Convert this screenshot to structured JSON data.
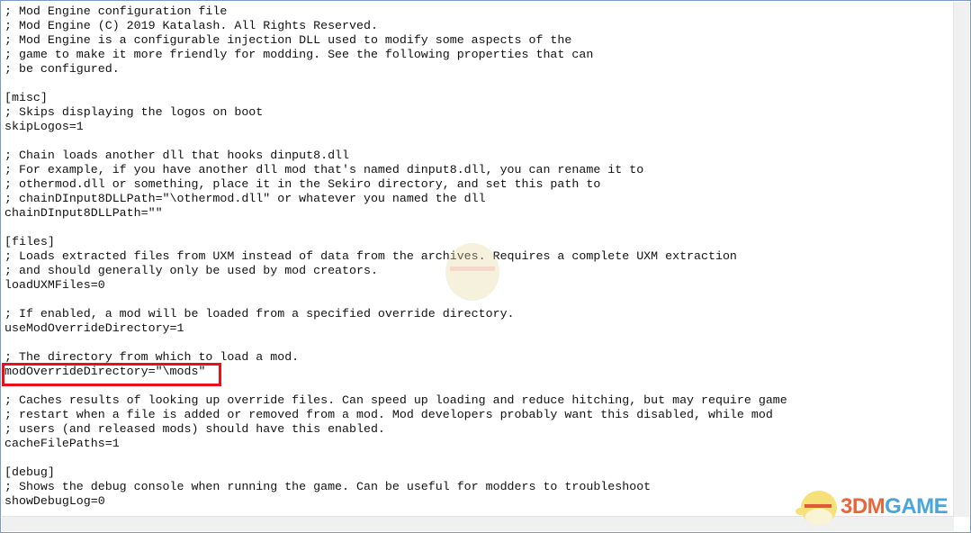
{
  "editor": {
    "lines": [
      "; Mod Engine configuration file",
      "; Mod Engine (C) 2019 Katalash. All Rights Reserved.",
      "; Mod Engine is a configurable injection DLL used to modify some aspects of the",
      "; game to make it more friendly for modding. See the following properties that can",
      "; be configured.",
      "",
      "[misc]",
      "; Skips displaying the logos on boot",
      "skipLogos=1",
      "",
      "; Chain loads another dll that hooks dinput8.dll",
      "; For example, if you have another dll mod that's named dinput8.dll, you can rename it to",
      "; othermod.dll or something, place it in the Sekiro directory, and set this path to",
      "; chainDInput8DLLPath=\"\\othermod.dll\" or whatever you named the dll",
      "chainDInput8DLLPath=\"\"",
      "",
      "[files]",
      "; Loads extracted files from UXM instead of data from the archives. Requires a complete UXM extraction",
      "; and should generally only be used by mod creators.",
      "loadUXMFiles=0",
      "",
      "; If enabled, a mod will be loaded from a specified override directory.",
      "useModOverrideDirectory=1",
      "",
      "; The directory from which to load a mod.",
      "modOverrideDirectory=\"\\mods\"",
      "",
      "; Caches results of looking up override files. Can speed up loading and reduce hitching, but may require game",
      "; restart when a file is added or removed from a mod. Mod developers probably want this disabled, while mod",
      "; users (and released mods) should have this enabled.",
      "cacheFilePaths=1",
      "",
      "[debug]",
      "; Shows the debug console when running the game. Can be useful for modders to troubleshoot",
      "showDebugLog=0"
    ]
  },
  "highlight": {
    "color": "#e8101a"
  },
  "watermark": {
    "part1": "3DM",
    "part2": "GAME"
  }
}
